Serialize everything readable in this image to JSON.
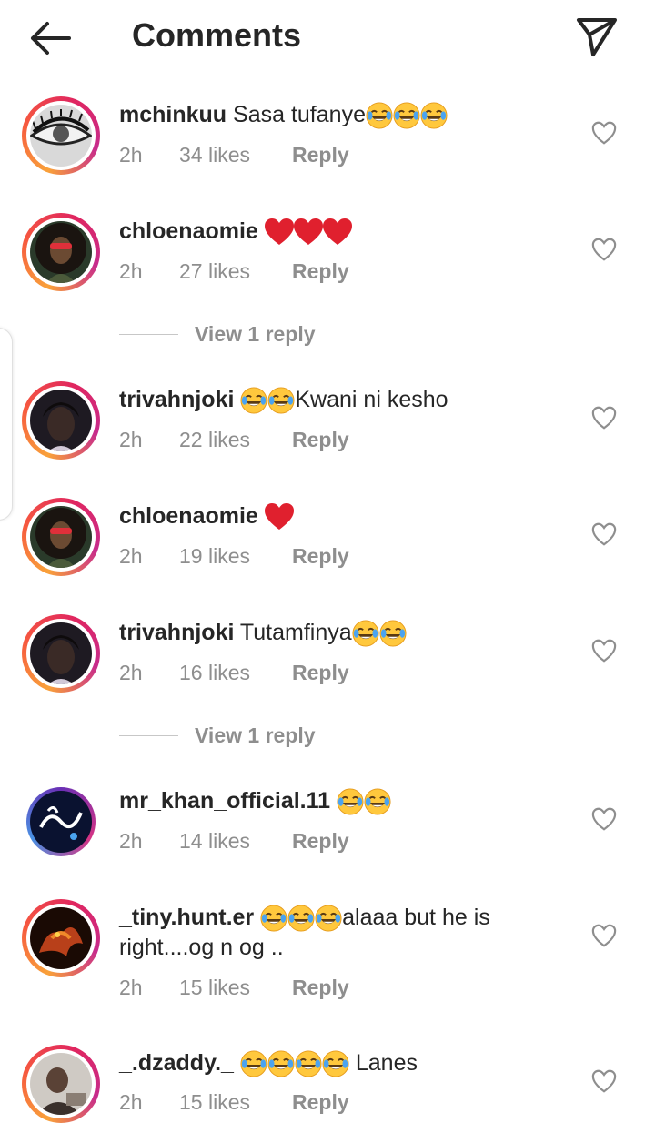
{
  "header": {
    "title": "Comments",
    "back_icon": "arrow-left-icon",
    "send_icon": "paper-plane-icon"
  },
  "comments": [
    {
      "username": "mchinkuu",
      "text": "Sasa tufanye",
      "emoji_after": "😂😂😂",
      "time": "2h",
      "likes": "34 likes",
      "reply": "Reply",
      "avatar": "eye-photo"
    },
    {
      "username": "chloenaomie",
      "text": "",
      "emoji_after": "❤️❤️❤️",
      "time": "2h",
      "likes": "27 likes",
      "reply": "Reply",
      "avatar": "girl-red-glasses-photo"
    },
    {
      "username": "trivahnjoki",
      "text": "Kwani ni kesho",
      "emoji_before": "😂😂",
      "time": "2h",
      "likes": "22 likes",
      "reply": "Reply",
      "avatar": "woman-portrait-photo"
    },
    {
      "username": "chloenaomie",
      "text": "",
      "emoji_after": "❤️",
      "time": "2h",
      "likes": "19 likes",
      "reply": "Reply",
      "avatar": "girl-red-glasses-photo"
    },
    {
      "username": "trivahnjoki",
      "text": "Tutamfinya",
      "emoji_after": "😂😂",
      "time": "2h",
      "likes": "16 likes",
      "reply": "Reply",
      "avatar": "woman-portrait-photo"
    },
    {
      "username": "mr_khan_official.11",
      "text": "",
      "emoji_after": "😂😂",
      "time": "2h",
      "likes": "14 likes",
      "reply": "Reply",
      "avatar": "calligraphy-photo"
    },
    {
      "username": "_tiny.hunt.er",
      "text": "alaaa but he is right....og n og ..",
      "emoji_before": "😂😂😂",
      "time": "2h",
      "likes": "15 likes",
      "reply": "Reply",
      "avatar": "dragon-photo"
    },
    {
      "username": "_.dzaddy._",
      "text": "Lanes",
      "emoji_before": "😂😂😂😂",
      "time": "2h",
      "likes": "15 likes",
      "reply": "Reply",
      "avatar": "person-photo"
    }
  ],
  "view_replies": [
    {
      "label": "View 1 reply"
    },
    {
      "label": "View 1 reply"
    }
  ],
  "colors": {
    "text": "#262626",
    "secondary": "#8e8e8e",
    "story_ring_start": "#f9a13a",
    "story_ring_end": "#c72b8c",
    "heart_red": "#e0202e",
    "laugh_yellow": "#ffc83d"
  }
}
